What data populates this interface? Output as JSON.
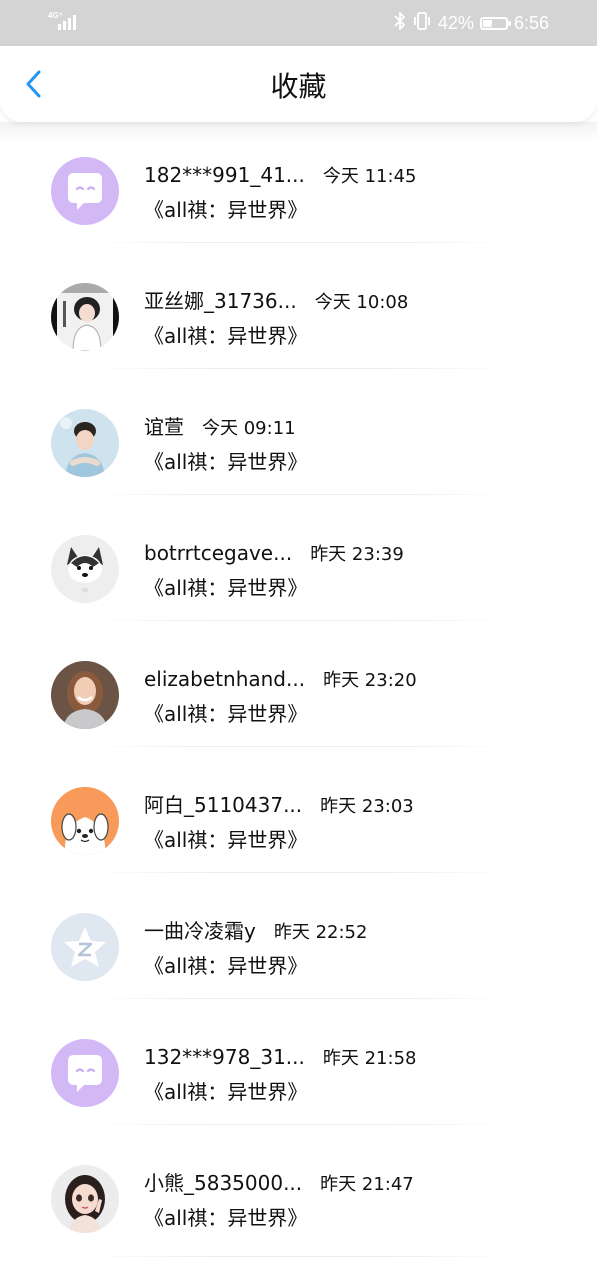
{
  "status_bar": {
    "network_label": "4G⁺",
    "battery_percent": "42%",
    "battery_level": 0.42,
    "time": "6:56",
    "icons": [
      "signal-icon",
      "bluetooth-icon",
      "vibrate-icon",
      "battery-icon"
    ]
  },
  "header": {
    "title": "收藏",
    "back_icon": "chevron-left-icon",
    "accent_color": "#2196f3"
  },
  "items": [
    {
      "name": "182***991_41...",
      "time": "今天 11:45",
      "book": "《all祺：异世界》",
      "avatar": "chat-bubble-purple"
    },
    {
      "name": "亚丝娜_31736...",
      "time": "今天 10:08",
      "book": "《all祺：异世界》",
      "avatar": "photo-anime-girl-bw"
    },
    {
      "name": "谊萱",
      "time": "今天 09:11",
      "book": "《all祺：异世界》",
      "avatar": "photo-boy-blue"
    },
    {
      "name": "botrrtcegave...",
      "time": "昨天 23:39",
      "book": "《all祺：异世界》",
      "avatar": "photo-dog-husky"
    },
    {
      "name": "elizabetnhand...",
      "time": "昨天 23:20",
      "book": "《all祺：异世界》",
      "avatar": "photo-woman-smiling"
    },
    {
      "name": "阿白_5110437...",
      "time": "昨天 23:03",
      "book": "《all祺：异世界》",
      "avatar": "cartoon-dog-orange"
    },
    {
      "name": "一曲冷凌霜y",
      "time": "昨天 22:52",
      "book": "《all祺：异世界》",
      "avatar": "qzone-star-grey"
    },
    {
      "name": "132***978_31...",
      "time": "昨天 21:58",
      "book": "《all祺：异世界》",
      "avatar": "chat-bubble-purple"
    },
    {
      "name": "小熊_5835000...",
      "time": "昨天 21:47",
      "book": "《all祺：异世界》",
      "avatar": "cartoon-doll-girl"
    }
  ]
}
